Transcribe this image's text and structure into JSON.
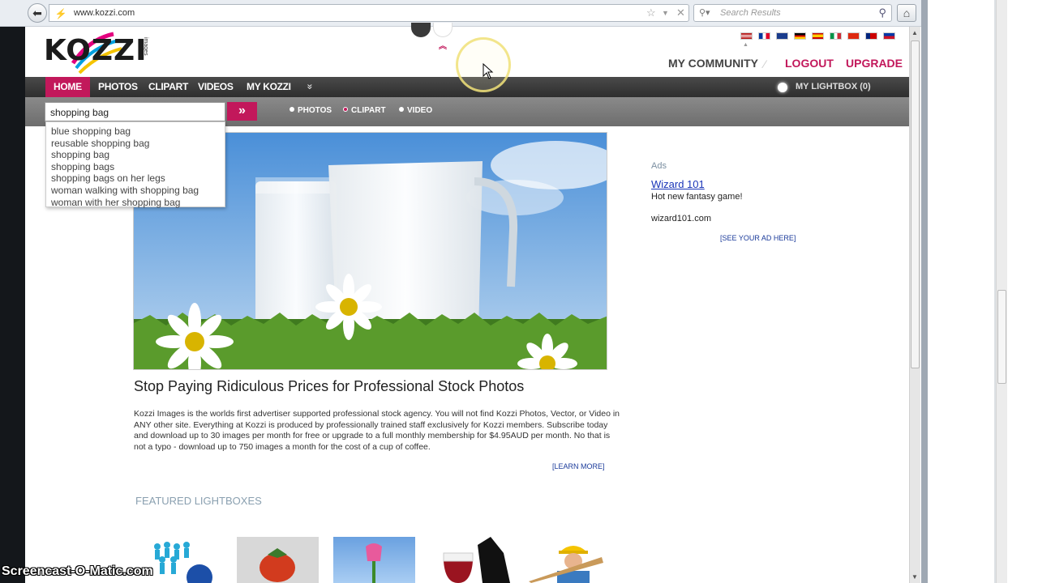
{
  "browser": {
    "url": "www.kozzi.com",
    "search_placeholder": "Search Results",
    "back_glyph": "⬅",
    "home_glyph": "⌂"
  },
  "site": {
    "logo_text": "KOZZI",
    "logo_sub": "images",
    "top_links": {
      "community": "MY COMMUNITY",
      "logout": "LOGOUT",
      "upgrade": "UPGRADE"
    },
    "nav": {
      "home": "HOME",
      "photos": "PHOTOS",
      "clipart": "CLIPART",
      "videos": "VIDEOS",
      "mykozzi": "MY KOZZI",
      "more_glyph": "»",
      "lightbox": "MY LIGHTBOX (0)"
    },
    "search": {
      "value": "shopping bag",
      "submit_glyph": "»",
      "filters": [
        "PHOTOS",
        "CLIPART",
        "VIDEO"
      ],
      "selected_filter": "CLIPART"
    },
    "autocomplete": [
      "blue shopping bag",
      "reusable shopping bag",
      "shopping bag",
      "shopping bags",
      "shopping bags on her legs",
      "woman walking with shopping bag",
      "woman with her shopping bag"
    ],
    "hero": {
      "title": "Stop Paying Ridiculous Prices for Professional Stock Photos",
      "description": "Kozzi Images is the worlds first advertiser supported professional stock agency. You will not find Kozzi Photos, Vector, or Video in ANY other site. Everything at Kozzi is produced by professionally trained staff exclusively for Kozzi members. Subscribe today and download up to 30 images per month for free or upgrade to a full monthly membership for $4.95AUD per month. No that is not a typo - download up to 750 images a month for the cost of a cup of coffee.",
      "learn_more": "[LEARN MORE]"
    },
    "featured_heading": "FEATURED LIGHTBOXES",
    "ads": {
      "label": "Ads",
      "title": "Wizard 101",
      "text": "Hot new fantasy game!",
      "url": "wizard101.com",
      "see_ad": "[SEE YOUR AD HERE]"
    }
  },
  "watermark": "Screencast-O-Matic.com",
  "colors": {
    "accent": "#c2185b",
    "nav_bg": "#3a3a3a",
    "link_blue": "#1a35b8"
  }
}
